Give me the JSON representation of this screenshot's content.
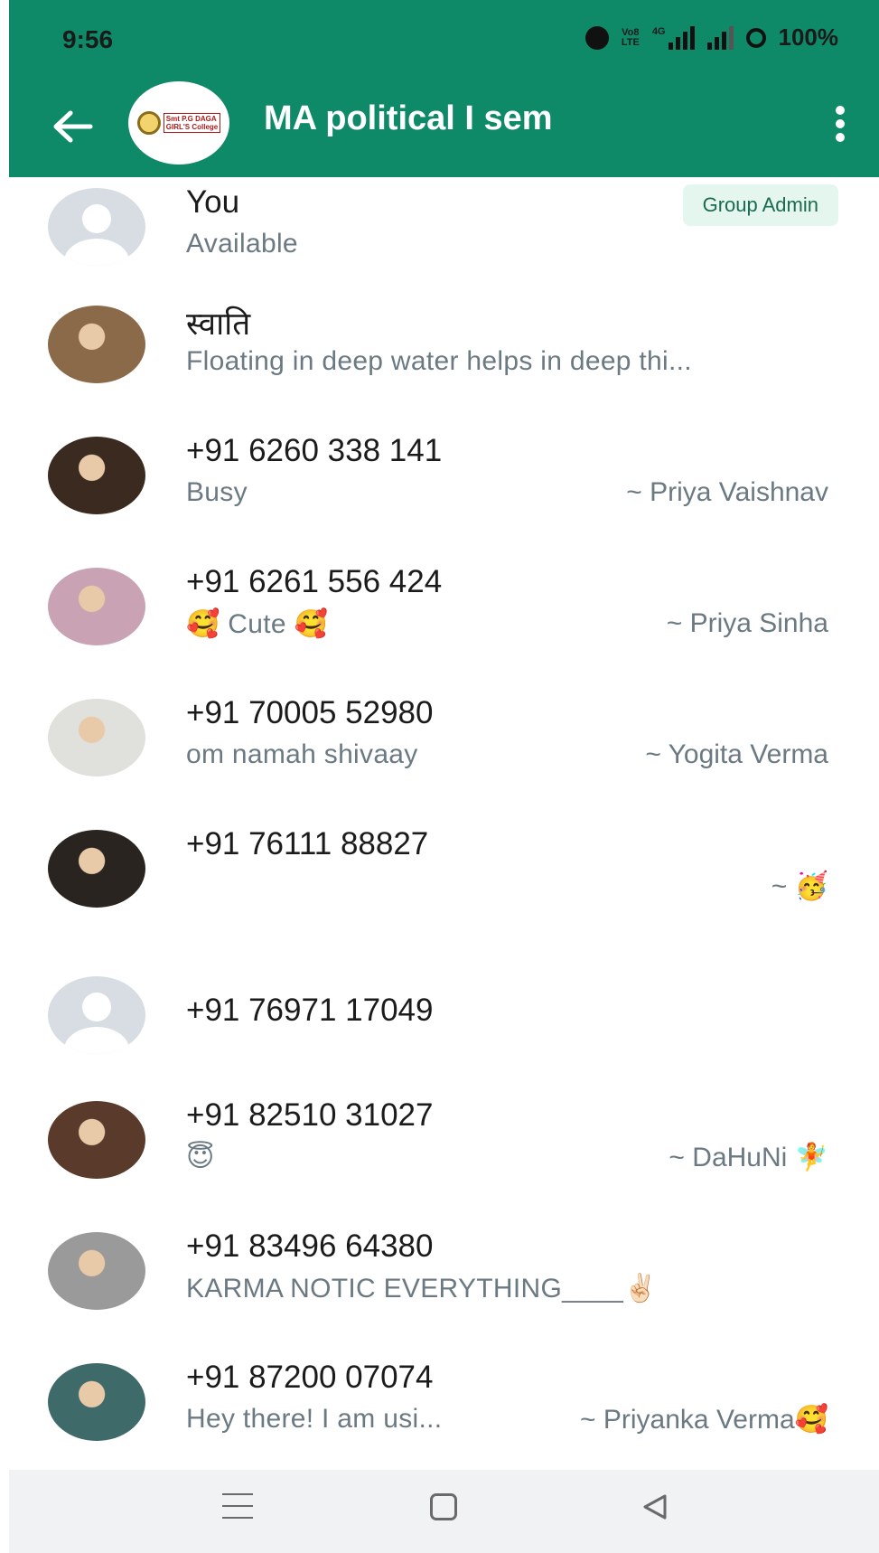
{
  "status_bar": {
    "time": "9:56",
    "volte_label_top": "Vo8",
    "volte_label_bottom": "LTE",
    "network_label": "4G",
    "battery": "100%"
  },
  "header": {
    "title": "MA political I sem",
    "logo_text_line1": "Smt P.G DAGA",
    "logo_text_line2": "GIRL'S College",
    "background_color": "#0f8a68"
  },
  "admin_badge": "Group Admin",
  "participants": [
    {
      "name": "You",
      "about": "Available",
      "push_name": "",
      "avatar": "default",
      "is_admin": true
    },
    {
      "name": "स्वाति",
      "about": "Floating in deep water helps in deep thi...",
      "push_name": "",
      "avatar": "photo"
    },
    {
      "name": "+91 6260 338 141",
      "about": "Busy",
      "push_name": "~ Priya Vaishnav",
      "avatar": "photo"
    },
    {
      "name": "+91 6261 556 424",
      "about": "🥰 Cute 🥰",
      "push_name": "~ Priya Sinha",
      "avatar": "photo"
    },
    {
      "name": "+91 70005 52980",
      "about": "om namah shivaay",
      "push_name": "~ Yogita Verma",
      "avatar": "photo"
    },
    {
      "name": "+91 76111 88827",
      "about": "",
      "push_name": "~ 🥳",
      "avatar": "photo"
    },
    {
      "name": "+91 76971 17049",
      "about": "",
      "push_name": "",
      "avatar": "default"
    },
    {
      "name": "+91 82510 31027",
      "about": "😇",
      "push_name": "~ DaHuNi 🧚",
      "avatar": "photo"
    },
    {
      "name": "+91 83496 64380",
      "about": "KARMA NOTIC EVERYTHING____✌🏻",
      "push_name": "",
      "avatar": "photo"
    },
    {
      "name": "+91 87200 07074",
      "about": "Hey there! I am usi...",
      "push_name": "~ Priyanka Verma🥰",
      "avatar": "photo"
    }
  ]
}
